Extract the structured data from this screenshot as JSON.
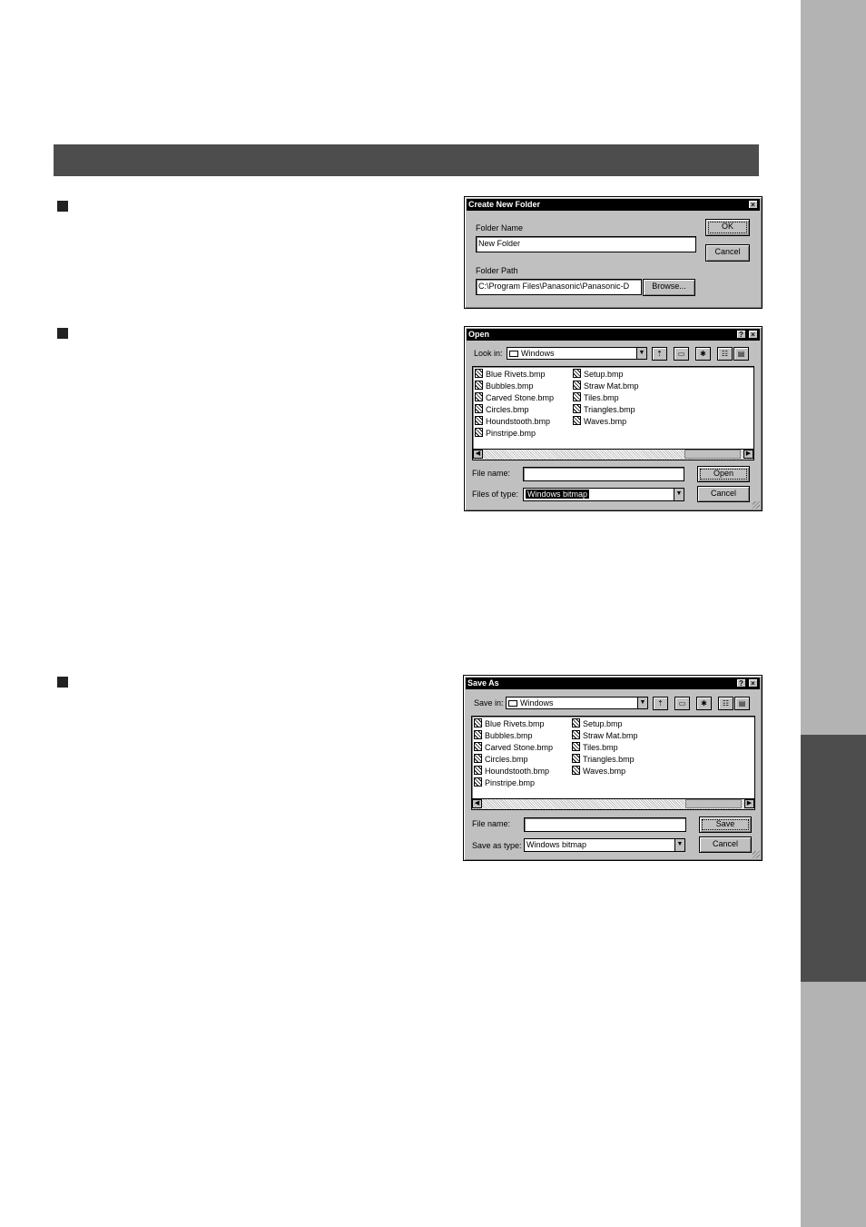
{
  "create_folder_dialog": {
    "title": "Create New Folder",
    "close_glyph": "×",
    "folder_name_label": "Folder Name",
    "folder_name_value": "New Folder",
    "folder_path_label": "Folder Path",
    "folder_path_value": "C:\\Program Files\\Panasonic\\Panasonic-D",
    "ok_label": "OK",
    "cancel_label": "Cancel",
    "browse_label": "Browse..."
  },
  "open_dialog": {
    "title": "Open",
    "help_glyph": "?",
    "close_glyph": "×",
    "look_in_label": "Look in:",
    "look_in_value": "Windows",
    "files_col1": [
      "Blue Rivets.bmp",
      "Bubbles.bmp",
      "Carved Stone.bmp",
      "Circles.bmp",
      "Houndstooth.bmp",
      "Pinstripe.bmp"
    ],
    "files_col2": [
      "Setup.bmp",
      "Straw Mat.bmp",
      "Tiles.bmp",
      "Triangles.bmp",
      "Waves.bmp"
    ],
    "file_name_label": "File name:",
    "file_name_value": "",
    "file_type_label": "Files of type:",
    "file_type_value": "Windows bitmap",
    "primary_label": "Open",
    "cancel_label": "Cancel"
  },
  "save_dialog": {
    "title": "Save As",
    "help_glyph": "?",
    "close_glyph": "×",
    "look_in_label": "Save in:",
    "look_in_value": "Windows",
    "files_col1": [
      "Blue Rivets.bmp",
      "Bubbles.bmp",
      "Carved Stone.bmp",
      "Circles.bmp",
      "Houndstooth.bmp",
      "Pinstripe.bmp"
    ],
    "files_col2": [
      "Setup.bmp",
      "Straw Mat.bmp",
      "Tiles.bmp",
      "Triangles.bmp",
      "Waves.bmp"
    ],
    "file_name_label": "File name:",
    "file_name_value": "",
    "file_type_label": "Save as type:",
    "file_type_value": "Windows bitmap",
    "primary_label": "Save",
    "cancel_label": "Cancel"
  },
  "icons": [
    "folder-icon",
    "up-folder-icon",
    "desktop-icon",
    "new-folder-icon",
    "list-view-icon",
    "details-view-icon",
    "bitmap-file-icon",
    "dropdown-arrow-icon",
    "scroll-left-icon",
    "scroll-right-icon",
    "resize-grip-icon"
  ],
  "colors": {
    "side_tab_light": "#b3b3b3",
    "side_tab_dark": "#4d4d4d",
    "section_bar": "#4d4d4d",
    "dialog_face": "#c0c0c0"
  }
}
